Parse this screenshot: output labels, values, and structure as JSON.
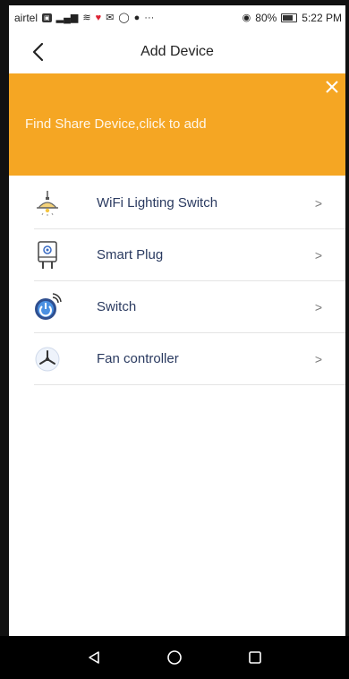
{
  "status_bar": {
    "carrier": "airtel",
    "battery_percent": "80%",
    "time": "5:22 PM",
    "overflow": "···"
  },
  "header": {
    "title": "Add Device",
    "back_icon": "chevron-left-icon"
  },
  "banner": {
    "text": "Find Share Device,click to add",
    "background": "#f5a623",
    "close_icon": "close-icon"
  },
  "devices": [
    {
      "label": "WiFi Lighting Switch",
      "icon": "lamp-icon"
    },
    {
      "label": "Smart Plug",
      "icon": "plug-icon"
    },
    {
      "label": "Switch",
      "icon": "power-switch-icon"
    },
    {
      "label": "Fan controller",
      "icon": "fan-icon"
    }
  ],
  "chevron": ">",
  "nav_bar": {
    "back": "back-triangle-icon",
    "home": "home-circle-icon",
    "recents": "recents-square-icon"
  }
}
